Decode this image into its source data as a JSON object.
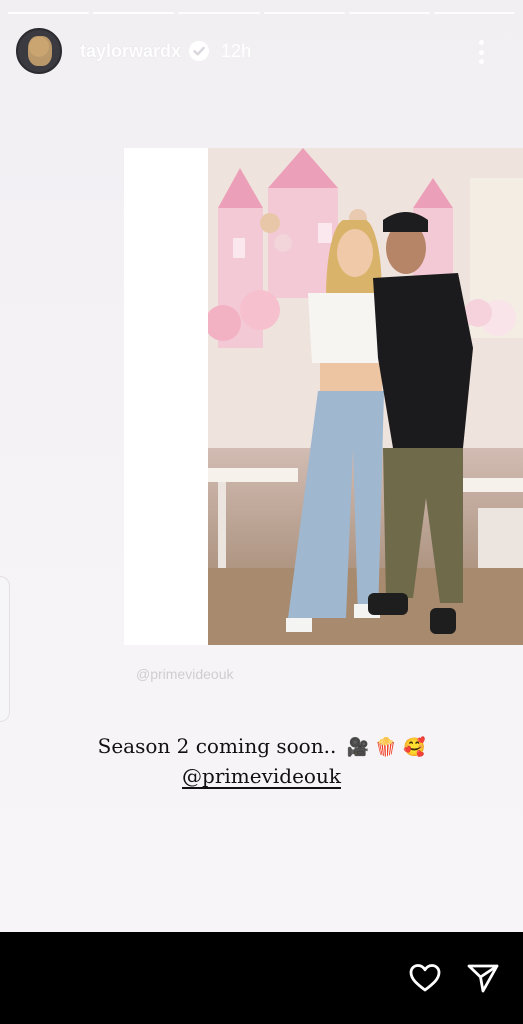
{
  "story": {
    "segments_total": 6,
    "segments_done": 2,
    "username": "taylorwardx",
    "timestamp": "12h",
    "verified": true
  },
  "post": {
    "watermark": "@primevideouk",
    "caption_text": "Season 2 coming soon..",
    "caption_emojis": "🎥 🍿 🥰",
    "mention": "@primevideouk"
  },
  "icons": {
    "more": "more-vertical-icon",
    "like": "heart-icon",
    "share": "send-icon"
  }
}
